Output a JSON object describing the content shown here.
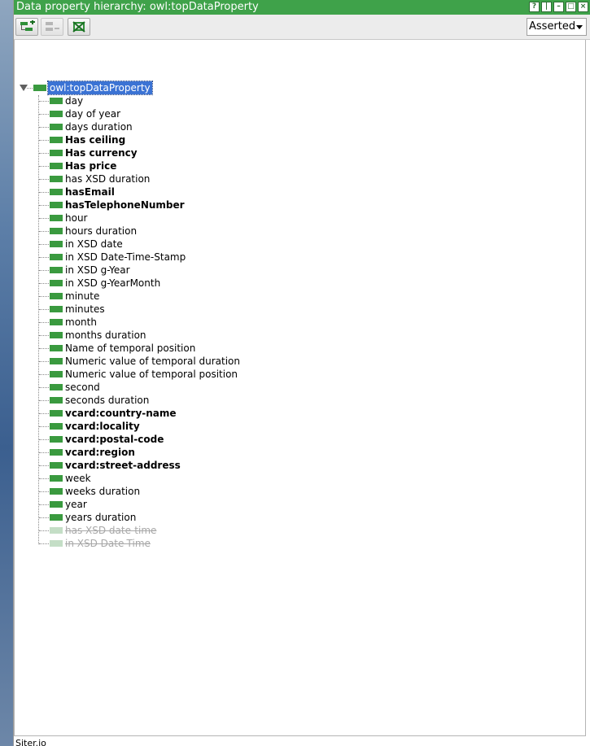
{
  "window": {
    "title": "Data property hierarchy: owl:topDataProperty",
    "buttons": [
      "?",
      "|",
      "–",
      "□",
      "×"
    ]
  },
  "toolbar": {
    "add_sub_icon": "add-subproperty-icon",
    "add_sibling_icon": "add-sibling-property-icon",
    "delete_icon": "delete-property-icon",
    "view_mode": "Asserted"
  },
  "tree": {
    "root": "owl:topDataProperty",
    "items": [
      {
        "label": "day",
        "style": "normal"
      },
      {
        "label": "day of year",
        "style": "normal"
      },
      {
        "label": "days duration",
        "style": "normal"
      },
      {
        "label": "Has ceiling",
        "style": "bold"
      },
      {
        "label": "Has currency",
        "style": "bold"
      },
      {
        "label": "Has price",
        "style": "bold"
      },
      {
        "label": "has XSD duration",
        "style": "normal"
      },
      {
        "label": "hasEmail",
        "style": "bold"
      },
      {
        "label": "hasTelephoneNumber",
        "style": "bold"
      },
      {
        "label": "hour",
        "style": "normal"
      },
      {
        "label": "hours duration",
        "style": "normal"
      },
      {
        "label": "in XSD date",
        "style": "normal"
      },
      {
        "label": "in XSD Date-Time-Stamp",
        "style": "normal"
      },
      {
        "label": "in XSD g-Year",
        "style": "normal"
      },
      {
        "label": "in XSD g-YearMonth",
        "style": "normal"
      },
      {
        "label": "minute",
        "style": "normal"
      },
      {
        "label": "minutes",
        "style": "normal"
      },
      {
        "label": "month",
        "style": "normal"
      },
      {
        "label": "months duration",
        "style": "normal"
      },
      {
        "label": "Name of temporal position",
        "style": "normal"
      },
      {
        "label": "Numeric value of temporal duration",
        "style": "normal"
      },
      {
        "label": "Numeric value of temporal position",
        "style": "normal"
      },
      {
        "label": "second",
        "style": "normal"
      },
      {
        "label": "seconds duration",
        "style": "normal"
      },
      {
        "label": "vcard:country-name",
        "style": "bold"
      },
      {
        "label": "vcard:locality",
        "style": "bold"
      },
      {
        "label": "vcard:postal-code",
        "style": "bold"
      },
      {
        "label": "vcard:region",
        "style": "bold"
      },
      {
        "label": "vcard:street-address",
        "style": "bold"
      },
      {
        "label": "week",
        "style": "normal"
      },
      {
        "label": "weeks duration",
        "style": "normal"
      },
      {
        "label": "year",
        "style": "normal"
      },
      {
        "label": "years duration",
        "style": "normal"
      },
      {
        "label": "has XSD date-time",
        "style": "deprecated"
      },
      {
        "label": "in XSD Date-Time",
        "style": "deprecated"
      }
    ]
  },
  "status": {
    "text": "Siter.io"
  },
  "colors": {
    "title_bar": "#3fa24a",
    "property_icon": "#3a9a3f",
    "selection": "#3b73d4",
    "deprecated_text": "#a8a8a8"
  }
}
